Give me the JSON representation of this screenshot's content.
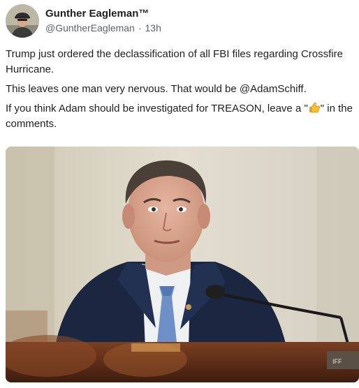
{
  "post": {
    "author": {
      "name": "Gunther Eagleman™",
      "handle": "@GuntherEagleman",
      "separator": "·",
      "timestamp": "13h",
      "avatar_icon": "profile-photo"
    },
    "text": {
      "line1": "Trump just ordered the declassification of all FBI files regarding Crossfire Hurricane.",
      "line2_prefix": "This leaves one man very nervous. That would be ",
      "line2_mention": "@AdamSchiff",
      "line2_suffix": ".",
      "line3_prefix": "If you think Adam should be investigated for TREASON, leave a \"",
      "line3_emoji": "thumbs-up-emoji",
      "line3_suffix": "\" in the comments."
    },
    "image": {
      "description_icon": "post-photo",
      "nameplate_text": "IFF"
    }
  },
  "colors": {
    "text_primary": "#1f1f1f",
    "text_secondary": "#5f6368",
    "suit": "#1b2740",
    "tie": "#6f8fc7",
    "background_wall": "#d8d4c6"
  }
}
